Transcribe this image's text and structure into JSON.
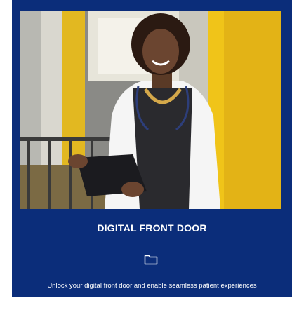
{
  "card": {
    "title": "DIGITAL FRONT DOOR",
    "description": "Unlock your digital front door and enable seamless patient experiences",
    "icon": "folder-icon"
  },
  "colors": {
    "card_background": "#0b2d7a",
    "text": "#ffffff",
    "accent_yellow": "#f0c419"
  }
}
